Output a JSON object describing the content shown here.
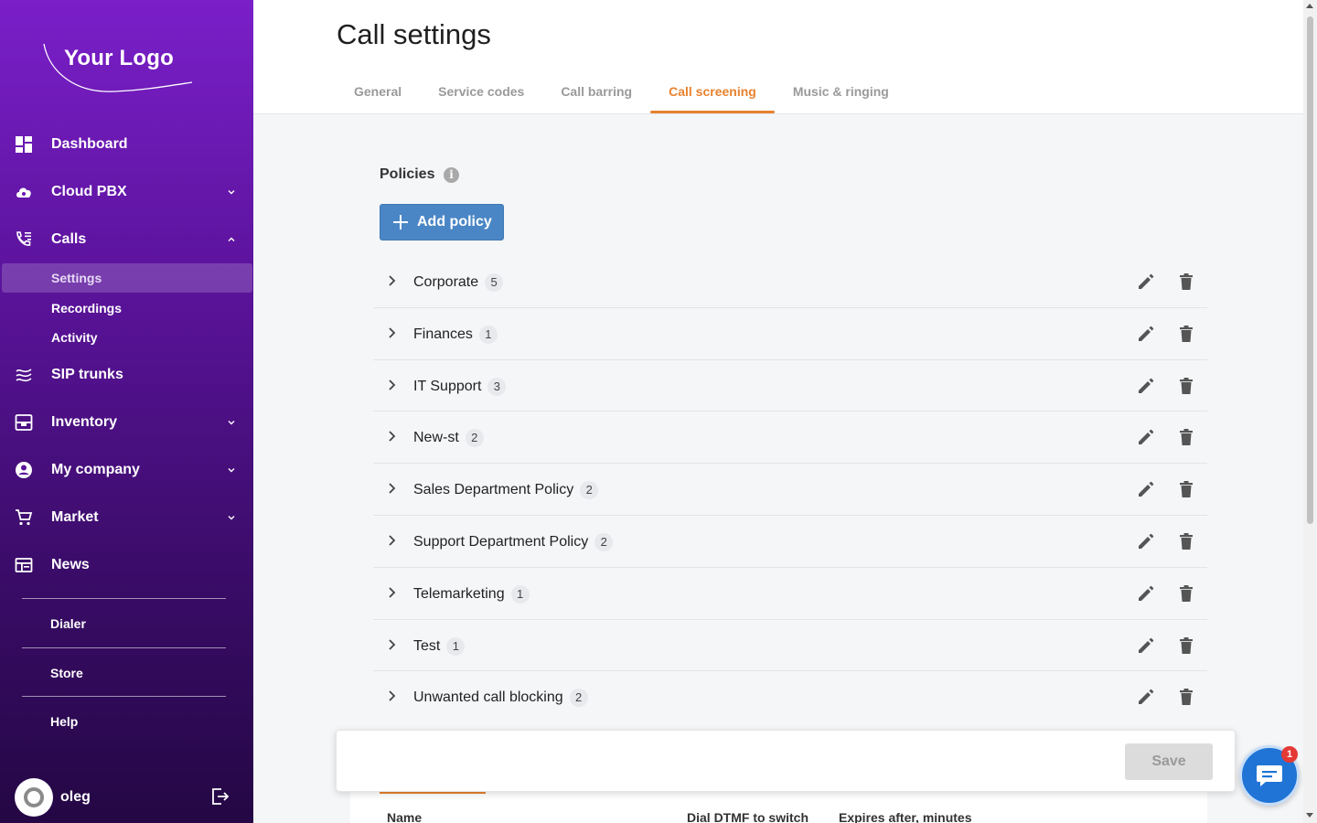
{
  "brand": {
    "logo_text": "Your Logo"
  },
  "sidebar": {
    "items": [
      {
        "label": "Dashboard",
        "icon": "dashboard-icon"
      },
      {
        "label": "Cloud PBX",
        "icon": "cloud-icon"
      },
      {
        "label": "Calls",
        "icon": "phone-list-icon"
      },
      {
        "label": "SIP trunks",
        "icon": "sip-trunk-icon"
      },
      {
        "label": "Inventory",
        "icon": "inventory-icon"
      },
      {
        "label": "My company",
        "icon": "account-circle-icon"
      },
      {
        "label": "Market",
        "icon": "cart-icon"
      },
      {
        "label": "News",
        "icon": "newspaper-icon"
      }
    ],
    "calls_subitems": [
      {
        "label": "Settings",
        "active": true
      },
      {
        "label": "Recordings"
      },
      {
        "label": "Activity"
      }
    ],
    "extras": [
      "Dialer",
      "Store",
      "Help"
    ],
    "user": {
      "name": "oleg"
    }
  },
  "header": {
    "title": "Call settings",
    "tabs": [
      {
        "label": "General"
      },
      {
        "label": "Service codes"
      },
      {
        "label": "Call barring"
      },
      {
        "label": "Call screening",
        "active": true
      },
      {
        "label": "Music & ringing"
      }
    ]
  },
  "policies": {
    "title": "Policies",
    "info": "i",
    "add_label": "Add policy",
    "rows": [
      {
        "name": "Corporate",
        "count": "5"
      },
      {
        "name": "Finances",
        "count": "1"
      },
      {
        "name": "IT Support",
        "count": "3"
      },
      {
        "name": "New-st",
        "count": "2"
      },
      {
        "name": "Sales Department Policy",
        "count": "2"
      },
      {
        "name": "Support Department Policy",
        "count": "2"
      },
      {
        "name": "Telemarketing",
        "count": "1"
      },
      {
        "name": "Test",
        "count": "1"
      },
      {
        "name": "Unwanted call blocking",
        "count": "2"
      }
    ]
  },
  "table": {
    "columns": [
      "Name",
      "Dial DTMF to switch",
      "Expires after, minutes"
    ]
  },
  "save_label": "Save",
  "chat": {
    "badge": "1"
  },
  "colors": {
    "accent": "#e8822f",
    "primary": "#4a86c5",
    "sidebar_top": "#7a1fc9",
    "sidebar_bottom": "#240744"
  }
}
